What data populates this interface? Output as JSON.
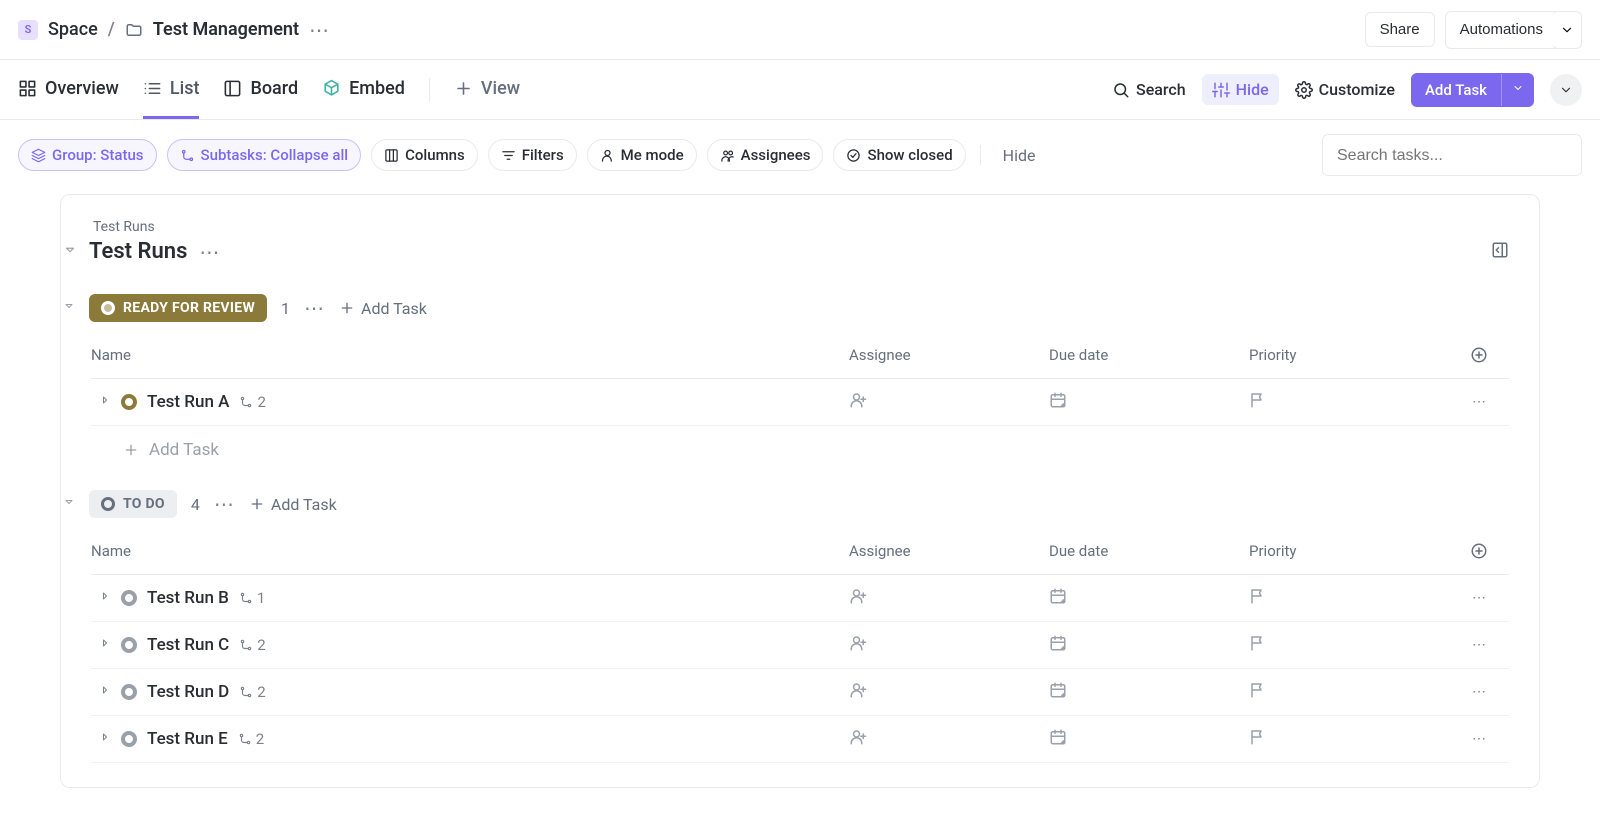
{
  "breadcrumb": {
    "space_initial": "S",
    "space_label": "Space",
    "folder_label": "Test Management"
  },
  "top_actions": {
    "share": "Share",
    "automations": "Automations"
  },
  "tabs": {
    "overview": "Overview",
    "list": "List",
    "board": "Board",
    "embed": "Embed",
    "add_view": "View"
  },
  "view_actions": {
    "search": "Search",
    "hide": "Hide",
    "customize": "Customize",
    "add_task": "Add Task"
  },
  "filters": {
    "group": "Group: Status",
    "subtasks": "Subtasks: Collapse all",
    "columns": "Columns",
    "filters": "Filters",
    "me_mode": "Me mode",
    "assignees": "Assignees",
    "show_closed": "Show closed",
    "hide": "Hide"
  },
  "search_placeholder": "Search tasks...",
  "panel": {
    "crumb": "Test Runs",
    "title": "Test Runs"
  },
  "columns": {
    "name": "Name",
    "assignee": "Assignee",
    "due": "Due date",
    "priority": "Priority"
  },
  "common": {
    "add_task": "Add Task"
  },
  "groups": [
    {
      "status": "READY FOR REVIEW",
      "status_kind": "review",
      "count": "1",
      "tasks": [
        {
          "title": "Test Run A",
          "subtasks": "2",
          "status": "review"
        }
      ]
    },
    {
      "status": "TO DO",
      "status_kind": "todo",
      "count": "4",
      "tasks": [
        {
          "title": "Test Run B",
          "subtasks": "1",
          "status": "todo"
        },
        {
          "title": "Test Run C",
          "subtasks": "2",
          "status": "todo"
        },
        {
          "title": "Test Run D",
          "subtasks": "2",
          "status": "todo"
        },
        {
          "title": "Test Run E",
          "subtasks": "2",
          "status": "todo"
        }
      ]
    }
  ]
}
